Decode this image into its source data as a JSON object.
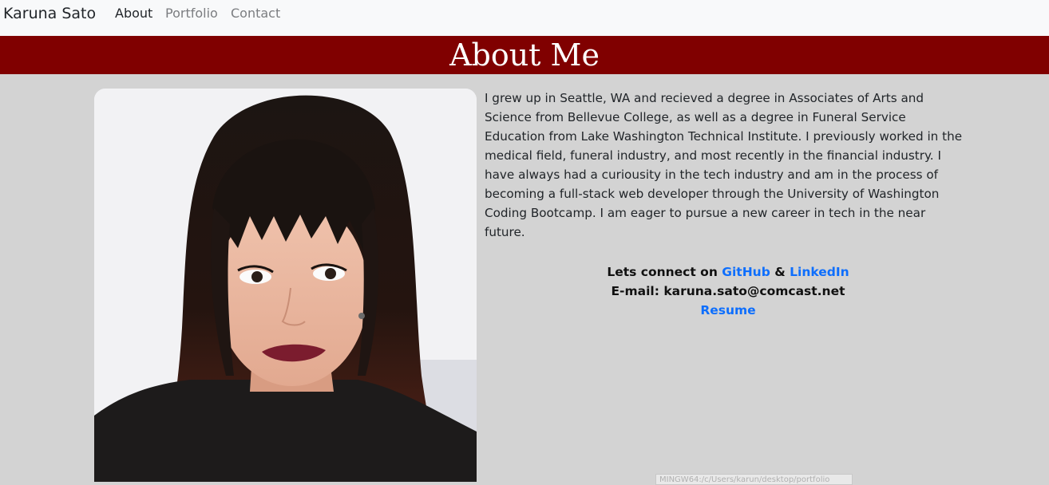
{
  "navbar": {
    "brand": "Karuna Sato",
    "links": [
      {
        "label": "About",
        "active": true
      },
      {
        "label": "Portfolio",
        "active": false
      },
      {
        "label": "Contact",
        "active": false
      }
    ]
  },
  "banner": {
    "title": "About Me",
    "color": "#800000"
  },
  "bio": {
    "text": "I grew up in Seattle, WA and recieved a degree in Associates of Arts and Science from Bellevue College, as well as a degree in Funeral Service Education from Lake Washington Technical Institute. I previously worked in the medical field, funeral industry, and most recently in the financial industry. I have always had a curiousity in the tech industry and am in the process of becoming a full-stack web developer through the University of Washington Coding Bootcamp. I am eager to pursue a new career in tech in the near future."
  },
  "connect": {
    "prefix": "Lets connect on ",
    "github": "GitHub",
    "amp": " & ",
    "linkedin": "LinkedIn",
    "email_label": "E-mail: ",
    "email": "karuna.sato@comcast.net",
    "resume": "Resume",
    "link_color": "#0d6efd"
  },
  "status_tip": "MINGW64:/c/Users/karun/desktop/portfolio"
}
